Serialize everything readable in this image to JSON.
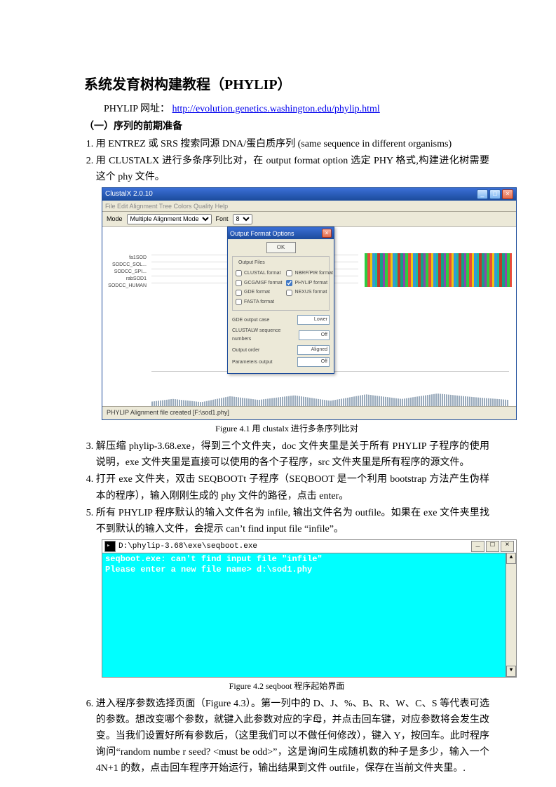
{
  "title": "系统发育树构建教程（PHYLIP）",
  "intro_prefix": "PHYLIP 网址：  ",
  "intro_link": "http://evolution.genetics.washington.edu/phylip.html",
  "section1": "（一）序列的前期准备",
  "list": {
    "i1": "用 ENTREZ 或 SRS 搜索同源 DNA/蛋白质序列  (same sequence in different organisms)",
    "i2": "用 CLUSTALX 进行多条序列比对，在 output format option 选定 PHY 格式,构建进化树需要这个 phy 文件。",
    "i3": "解压缩 phylip-3.68.exe，得到三个文件夹，doc 文件夹里是关于所有 PHYLIP 子程序的使用说明，exe 文件夹里是直接可以使用的各个子程序，src 文件夹里是所有程序的源文件。",
    "i4": "打开 exe 文件夹，双击 SEQBOOTt 子程序（SEQBOOT 是一个利用 bootstrap 方法产生伪样本的程序），输入刚刚生成的 phy 文件的路径，点击 enter。",
    "i5": "所有 PHYLIP 程序默认的输入文件名为 infile,  输出文件名为 outfile。如果在 exe 文件夹里找不到默认的输入文件，会提示 can’t find input file “infile”。",
    "i6": "进入程序参数选择页面（Figure 4.3）。第一列中的 D、J、%、B、R、W、C、S 等代表可选的参数。想改变哪个参数，就键入此参数对应的字母，并点击回车键，对应参数将会发生改变。当我们设置好所有参数后，（这里我们可以不做任何修改），键入 Y，按回车。此时程序询问“random numbe r seed? <must be odd>”，这是询问生成随机数的种子是多少，输入一个 4N+1 的数，点击回车程序开始运行，输出结果到文件 outfile，保存在当前文件夹里。."
  },
  "fig1": {
    "caption": "Figure 4.1  用 clustalx 进行多条序列比对",
    "win_title": "ClustalX 2.0.10",
    "menu": "File   Edit  Alignment  Tree  Colors  Quality  Help",
    "toolbar_mode": "Mode",
    "toolbar_mode_val": "Multiple Alignment Mode",
    "toolbar_font": "Font",
    "toolbar_font_val": "8",
    "seqs": [
      "fa1SOD",
      "SODCC_SOL...",
      "SODCC_SPI...",
      "rabSOD1",
      "SODCC_HUMAN"
    ],
    "ofo_title": "Output Format Options",
    "ofo_ok": "OK",
    "ofo_group_label": "Output Files",
    "ofo_c1": "CLUSTAL format",
    "ofo_c2": "NBRF/PIR format",
    "ofo_c3": "GCG/MSF format",
    "ofo_c4": "PHYLIP format",
    "ofo_c5": "GDE format",
    "ofo_c6": "NEXUS format",
    "ofo_c7": "FASTA format",
    "ofo_f1": "GDE output case",
    "ofo_f1v": "Lower",
    "ofo_f2": "CLUSTALW sequence numbers",
    "ofo_f2v": "Off",
    "ofo_f3": "Output order",
    "ofo_f3v": "Aligned",
    "ofo_f4": "Parameters output",
    "ofo_f4v": "Off",
    "status": "PHYLIP Alignment file created   [F:\\sod1.phy]"
  },
  "fig2": {
    "caption": "Figure 4.2 seqboot 程序起始界面",
    "title": "D:\\phylip-3.68\\exe\\seqboot.exe",
    "line1": "seqboot.exe: can't find input file \"infile\"",
    "line2": "Please enter a new file name> d:\\sod1.phy"
  }
}
